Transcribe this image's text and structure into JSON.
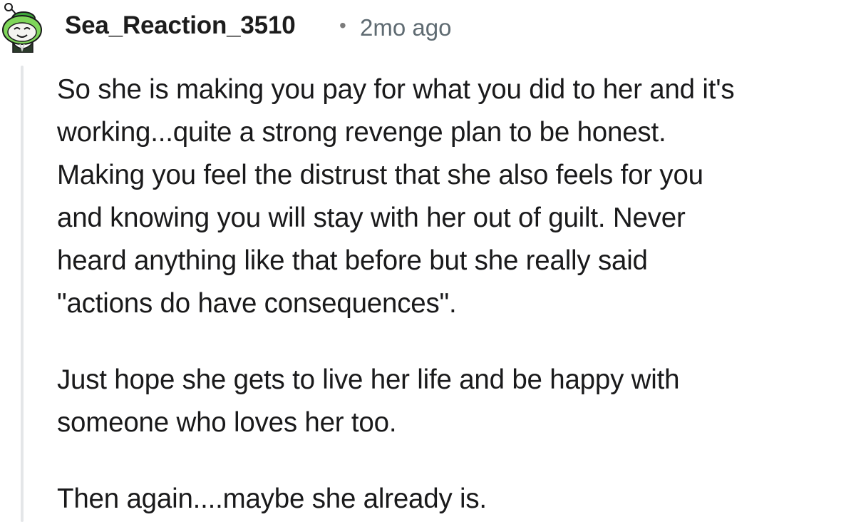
{
  "comment": {
    "author": "Sea_Reaction_3510",
    "separator": "•",
    "timestamp": "2mo ago",
    "avatar_icon": "snoo-avatar-green-hat-icon",
    "paragraph1_lines": [
      "So she is making you pay for what you did to her and it's",
      "working...quite a strong revenge plan to be honest.",
      "Making you feel the distrust that she also feels for you",
      "and knowing you will stay with her out of guilt. Never",
      "heard anything like that before but she really said",
      "\"actions do have consequences\"."
    ],
    "paragraph2_lines": [
      "Just hope she gets to live her life and be happy with",
      "someone who loves her too."
    ],
    "paragraph3_lines": [
      "Then again....maybe she already is."
    ]
  },
  "colors": {
    "avatar_green": "#7fd65a",
    "thread_line": "#e4e6e8",
    "meta_text": "#5f6b72"
  }
}
